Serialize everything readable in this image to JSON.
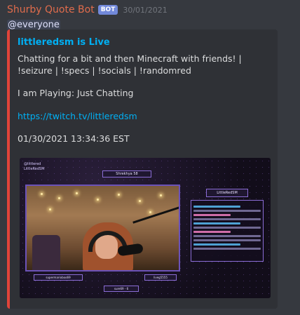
{
  "message": {
    "username": "Shurby Quote Bot",
    "bot_tag": "BOT",
    "timestamp": "30/01/2021",
    "mention": "@everyone"
  },
  "embed": {
    "color": "#e0433a",
    "title": "littleredsm is Live",
    "description": "Chatting for a bit and then Minecraft with friends! | !seizure | !specs | !socials | !randomred",
    "playing": "I am Playing: Just Chatting",
    "link": "https://twitch.tv/littleredsm",
    "datetime": "01/30/2021 13:34:36 EST"
  },
  "thumbnail": {
    "social_1": "@littlered",
    "social_2": "LittleRedSM",
    "top_plate": "Shrekhya 58",
    "chat_title": "LittleRedSM",
    "bottom_left": "supermarioboo69",
    "bottom_mid": "sure69 - 6",
    "bottom_right": "liveg5555"
  }
}
